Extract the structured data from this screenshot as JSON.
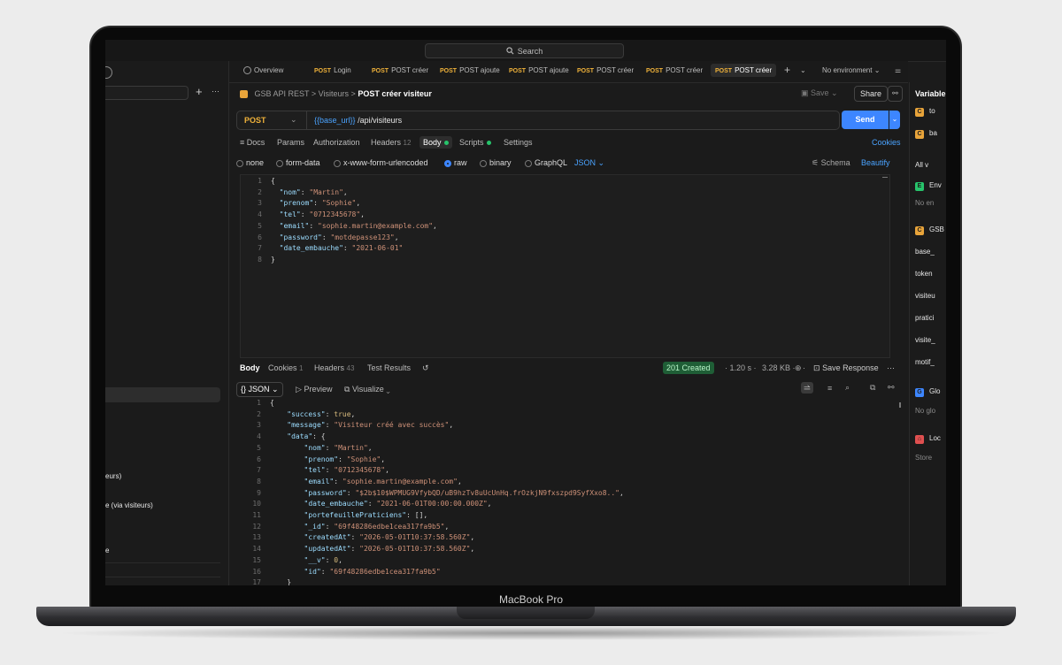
{
  "device": {
    "brand": "MacBook Pro"
  },
  "topbar": {
    "search_label": "Search"
  },
  "sidebar": {
    "plus": "+",
    "more": "···",
    "items": [
      {
        "label": "eurs)"
      },
      {
        "label": "e (via visiteurs)"
      },
      {
        "label": "e"
      }
    ]
  },
  "tabs": {
    "overview": "Overview",
    "items": [
      {
        "method": "POST",
        "label": "Login"
      },
      {
        "method": "POST",
        "label": "POST créer"
      },
      {
        "method": "POST",
        "label": "POST ajoute"
      },
      {
        "method": "POST",
        "label": "POST ajoute"
      },
      {
        "method": "POST",
        "label": "POST créer"
      },
      {
        "method": "POST",
        "label": "POST créer"
      },
      {
        "method": "POST",
        "label": "POST créer"
      }
    ],
    "add": "+",
    "environment": "No environment"
  },
  "breadcrumb": {
    "collection": "GSB API REST",
    "sep1": ">",
    "folder": "Visiteurs",
    "sep2": ">",
    "current": "POST créer visiteur"
  },
  "actions": {
    "save": "Save",
    "share": "Share"
  },
  "request": {
    "method": "POST",
    "url_var": "{{base_url}}",
    "url_path": "/api/visiteurs",
    "send": "Send"
  },
  "request_tabs": {
    "docs": "Docs",
    "params": "Params",
    "authorization": "Authorization",
    "headers": "Headers",
    "headers_count": "12",
    "body": "Body",
    "scripts": "Scripts",
    "settings": "Settings",
    "cookies": "Cookies"
  },
  "body_types": {
    "none": "none",
    "form_data": "form-data",
    "urlencoded": "x-www-form-urlencoded",
    "raw": "raw",
    "binary": "binary",
    "graphql": "GraphQL",
    "json": "JSON",
    "schema": "Schema",
    "beautify": "Beautify"
  },
  "request_body": [
    {
      "n": "1",
      "parts": [
        [
          "p",
          "{"
        ]
      ]
    },
    {
      "n": "2",
      "parts": [
        [
          "p",
          "  "
        ],
        [
          "k",
          "\"nom\""
        ],
        [
          "p",
          ": "
        ],
        [
          "s",
          "\"Martin\""
        ],
        [
          "p",
          ","
        ]
      ]
    },
    {
      "n": "3",
      "parts": [
        [
          "p",
          "  "
        ],
        [
          "k",
          "\"prenom\""
        ],
        [
          "p",
          ": "
        ],
        [
          "s",
          "\"Sophie\""
        ],
        [
          "p",
          ","
        ]
      ]
    },
    {
      "n": "4",
      "parts": [
        [
          "p",
          "  "
        ],
        [
          "k",
          "\"tel\""
        ],
        [
          "p",
          ": "
        ],
        [
          "s",
          "\"0712345678\""
        ],
        [
          "p",
          ","
        ]
      ]
    },
    {
      "n": "5",
      "parts": [
        [
          "p",
          "  "
        ],
        [
          "k",
          "\"email\""
        ],
        [
          "p",
          ": "
        ],
        [
          "s",
          "\"sophie.martin@example.com\""
        ],
        [
          "p",
          ","
        ]
      ]
    },
    {
      "n": "6",
      "parts": [
        [
          "p",
          "  "
        ],
        [
          "k",
          "\"password\""
        ],
        [
          "p",
          ": "
        ],
        [
          "s",
          "\"motdepasse123\""
        ],
        [
          "p",
          ","
        ]
      ]
    },
    {
      "n": "7",
      "parts": [
        [
          "p",
          "  "
        ],
        [
          "k",
          "\"date_embauche\""
        ],
        [
          "p",
          ": "
        ],
        [
          "s",
          "\"2021-06-01\""
        ]
      ]
    },
    {
      "n": "8",
      "parts": [
        [
          "p",
          "}"
        ]
      ]
    }
  ],
  "response": {
    "tabs": {
      "body": "Body",
      "cookies": "Cookies",
      "cookies_count": "1",
      "headers": "Headers",
      "headers_count": "43",
      "test_results": "Test Results"
    },
    "status": "201 Created",
    "time": "1.20 s",
    "size": "3.28 KB",
    "save_response": "Save Response",
    "format": "JSON",
    "preview": "Preview",
    "visualize": "Visualize",
    "body": [
      {
        "n": "1",
        "parts": [
          [
            "p",
            "{"
          ]
        ]
      },
      {
        "n": "2",
        "parts": [
          [
            "p",
            "    "
          ],
          [
            "k",
            "\"success\""
          ],
          [
            "p",
            ": "
          ],
          [
            "b",
            "true"
          ],
          [
            "p",
            ","
          ]
        ]
      },
      {
        "n": "3",
        "parts": [
          [
            "p",
            "    "
          ],
          [
            "k",
            "\"message\""
          ],
          [
            "p",
            ": "
          ],
          [
            "s",
            "\"Visiteur créé avec succès\""
          ],
          [
            "p",
            ","
          ]
        ]
      },
      {
        "n": "4",
        "parts": [
          [
            "p",
            "    "
          ],
          [
            "k",
            "\"data\""
          ],
          [
            "p",
            ": {"
          ]
        ]
      },
      {
        "n": "5",
        "parts": [
          [
            "p",
            "        "
          ],
          [
            "k",
            "\"nom\""
          ],
          [
            "p",
            ": "
          ],
          [
            "s",
            "\"Martin\""
          ],
          [
            "p",
            ","
          ]
        ]
      },
      {
        "n": "6",
        "parts": [
          [
            "p",
            "        "
          ],
          [
            "k",
            "\"prenom\""
          ],
          [
            "p",
            ": "
          ],
          [
            "s",
            "\"Sophie\""
          ],
          [
            "p",
            ","
          ]
        ]
      },
      {
        "n": "7",
        "parts": [
          [
            "p",
            "        "
          ],
          [
            "k",
            "\"tel\""
          ],
          [
            "p",
            ": "
          ],
          [
            "s",
            "\"0712345678\""
          ],
          [
            "p",
            ","
          ]
        ]
      },
      {
        "n": "8",
        "parts": [
          [
            "p",
            "        "
          ],
          [
            "k",
            "\"email\""
          ],
          [
            "p",
            ": "
          ],
          [
            "s",
            "\"sophie.martin@example.com\""
          ],
          [
            "p",
            ","
          ]
        ]
      },
      {
        "n": "9",
        "parts": [
          [
            "p",
            "        "
          ],
          [
            "k",
            "\"password\""
          ],
          [
            "p",
            ": "
          ],
          [
            "s",
            "\"$2b$10$WPMUG9VfybQD/uB9hzTv8uUcUnHq.frOzkjN9fxszpd9SyfXxo8..\""
          ],
          [
            "p",
            ","
          ]
        ]
      },
      {
        "n": "10",
        "parts": [
          [
            "p",
            "        "
          ],
          [
            "k",
            "\"date_embauche\""
          ],
          [
            "p",
            ": "
          ],
          [
            "s",
            "\"2021-06-01T00:00:00.000Z\""
          ],
          [
            "p",
            ","
          ]
        ]
      },
      {
        "n": "11",
        "parts": [
          [
            "p",
            "        "
          ],
          [
            "k",
            "\"portefeuillePraticiens\""
          ],
          [
            "p",
            ": [],"
          ]
        ]
      },
      {
        "n": "12",
        "parts": [
          [
            "p",
            "        "
          ],
          [
            "k",
            "\"_id\""
          ],
          [
            "p",
            ": "
          ],
          [
            "s",
            "\"69f48286edbe1cea317fa9b5\""
          ],
          [
            "p",
            ","
          ]
        ]
      },
      {
        "n": "13",
        "parts": [
          [
            "p",
            "        "
          ],
          [
            "k",
            "\"createdAt\""
          ],
          [
            "p",
            ": "
          ],
          [
            "s",
            "\"2026-05-01T10:37:58.560Z\""
          ],
          [
            "p",
            ","
          ]
        ]
      },
      {
        "n": "14",
        "parts": [
          [
            "p",
            "        "
          ],
          [
            "k",
            "\"updatedAt\""
          ],
          [
            "p",
            ": "
          ],
          [
            "s",
            "\"2026-05-01T10:37:58.560Z\""
          ],
          [
            "p",
            ","
          ]
        ]
      },
      {
        "n": "15",
        "parts": [
          [
            "p",
            "        "
          ],
          [
            "k",
            "\"__v\""
          ],
          [
            "p",
            ": "
          ],
          [
            "b",
            "0"
          ],
          [
            "p",
            ","
          ]
        ]
      },
      {
        "n": "16",
        "parts": [
          [
            "p",
            "        "
          ],
          [
            "k",
            "\"id\""
          ],
          [
            "p",
            ": "
          ],
          [
            "s",
            "\"69f48286edbe1cea317fa9b5\""
          ]
        ]
      },
      {
        "n": "17",
        "parts": [
          [
            "p",
            "    }"
          ]
        ]
      }
    ]
  },
  "right_panel": {
    "title": "Variable",
    "items": [
      {
        "chip": "C",
        "chip_color": "#e8a43a",
        "label": "to"
      },
      {
        "chip": "C",
        "chip_color": "#e8a43a",
        "label": "ba"
      },
      {
        "chip": "",
        "chip_color": "",
        "label": "All v"
      },
      {
        "chip": "E",
        "chip_color": "#27c46b",
        "label": "Env"
      },
      {
        "chip": "",
        "chip_color": "",
        "label": "No en"
      },
      {
        "chip": "C",
        "chip_color": "#e8a43a",
        "label": "GSB"
      },
      {
        "chip": "",
        "chip_color": "",
        "label": "base_"
      },
      {
        "chip": "",
        "chip_color": "",
        "label": "token"
      },
      {
        "chip": "",
        "chip_color": "",
        "label": "visiteu"
      },
      {
        "chip": "",
        "chip_color": "",
        "label": "pratici"
      },
      {
        "chip": "",
        "chip_color": "",
        "label": "visite_"
      },
      {
        "chip": "",
        "chip_color": "",
        "label": "motif_"
      },
      {
        "chip": "G",
        "chip_color": "#3d86ff",
        "label": "Glo"
      },
      {
        "chip": "",
        "chip_color": "",
        "label": "No glo"
      },
      {
        "chip": "⌂",
        "chip_color": "#e05050",
        "label": "Loc"
      },
      {
        "chip": "",
        "chip_color": "",
        "label": "Store"
      }
    ]
  },
  "colors": {
    "accent": "#3d86ff",
    "post": "#f0b23a",
    "success": "#27c46b"
  }
}
